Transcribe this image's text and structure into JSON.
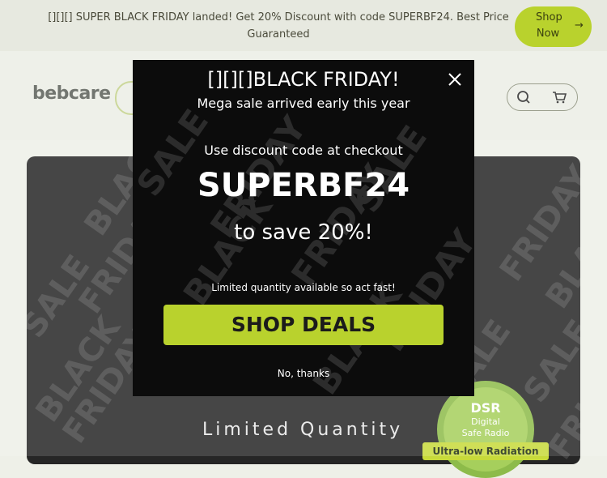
{
  "banner": {
    "text": "[][][] SUPER BLACK FRIDAY landed! Get 20% Discount with code SUPERBF24. Best Price Guaranteed",
    "shop_now": "Shop Now",
    "arrow": "→"
  },
  "header": {
    "logo": "bebcare",
    "search_icon": "search-icon",
    "cart_icon": "cart-icon"
  },
  "hero": {
    "background_words": [
      "BLACK",
      "FRIDAY",
      "SALE",
      "BLACK",
      "FRIDAY",
      "SALE",
      "FRIDAY",
      "BLACK",
      "SALE",
      "FRIDAY"
    ],
    "limited": "Limited  Quantity",
    "badge": {
      "dsr": "DSR",
      "line2": "Digital",
      "line3": "Safe Radio",
      "ribbon": "Ultra-low Radiation"
    }
  },
  "popup": {
    "title": "[][][]BLACK FRIDAY!",
    "subtitle": "Mega sale arrived early this year",
    "use_code": "Use discount code at checkout",
    "code": "SUPERBF24",
    "save": "to save 20%!",
    "limited_note": "Limited quantity available so act fast!",
    "cta": "SHOP DEALS",
    "dismiss": "No, thanks",
    "close_icon": "close-icon"
  },
  "colors": {
    "accent": "#b9d22d",
    "modal_bg": "#0c0c0c",
    "hero_bg": "#262626"
  }
}
